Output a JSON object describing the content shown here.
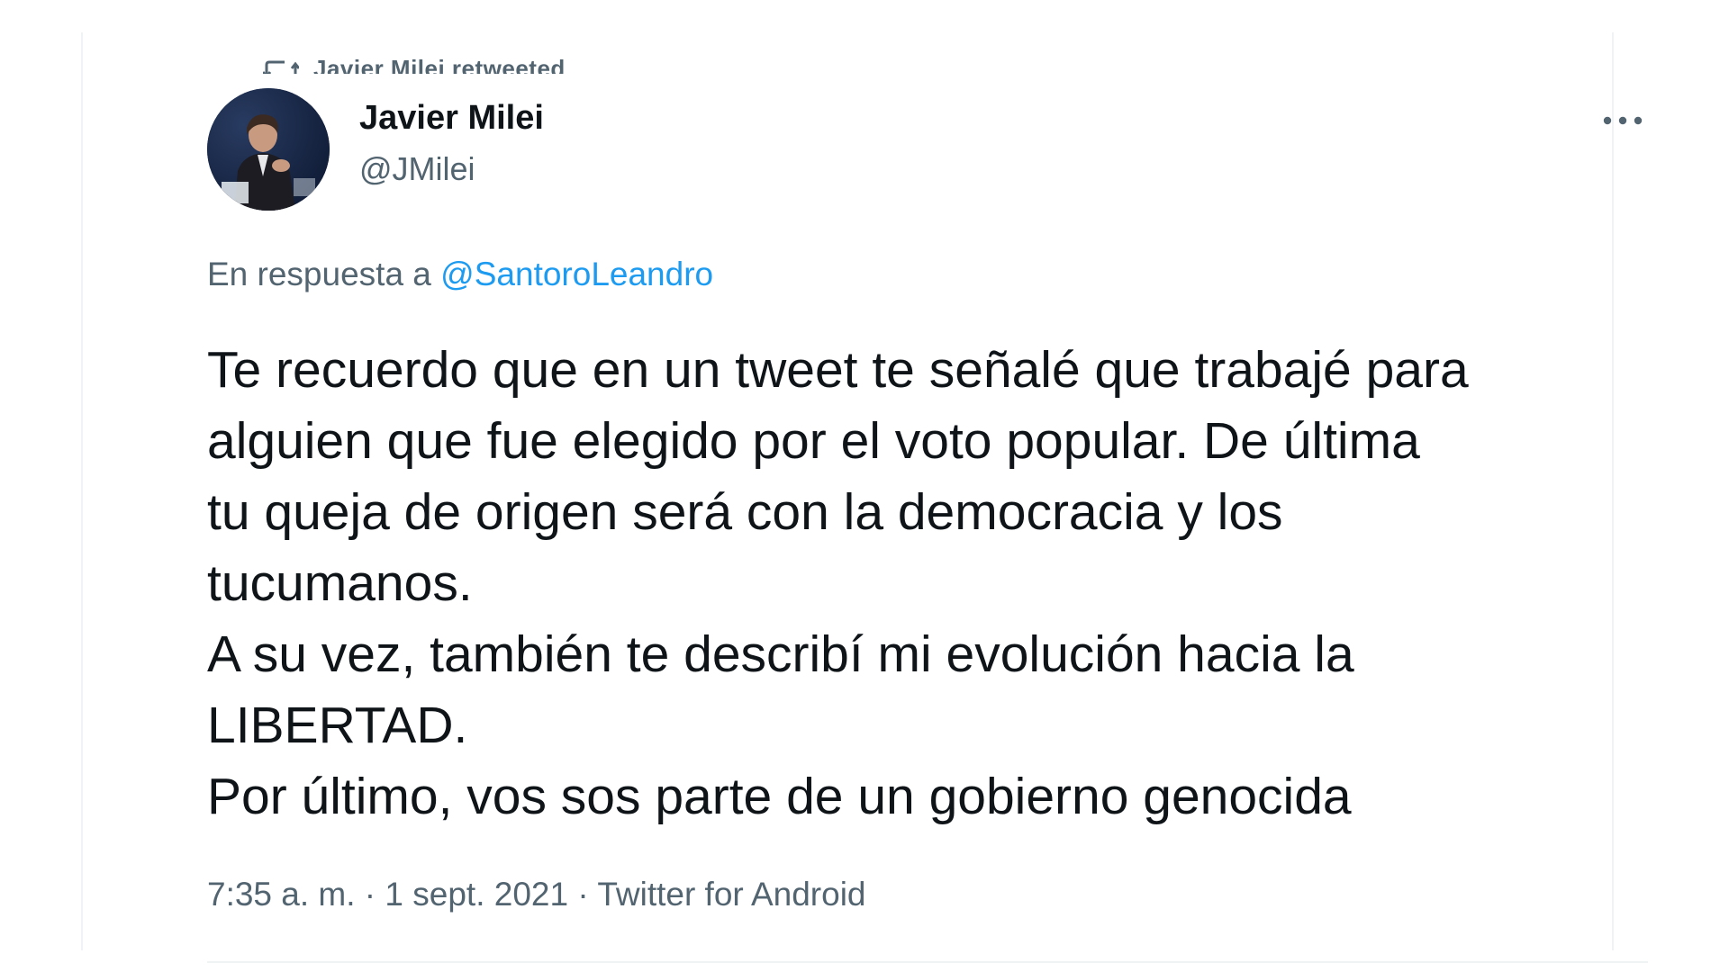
{
  "retweet": {
    "text": "Javier Milei retweeted"
  },
  "author": {
    "name": "Javier Milei",
    "handle": "@JMilei",
    "avatar_icon": "profile-photo-icon"
  },
  "reply": {
    "prefix": "En respuesta a ",
    "mention": "@SantoroLeandro"
  },
  "tweet": {
    "lines": [
      "Te recuerdo que en un tweet te señalé que trabajé para",
      "alguien que fue elegido por el voto popular. De última",
      "tu queja de origen será con la democracia y los",
      "tucumanos.",
      "A su vez, también te describí mi evolución hacia la",
      "LIBERTAD.",
      "Por último, vos sos parte de un gobierno genocida"
    ]
  },
  "meta": {
    "time": "7:35 a. m.",
    "separator": " · ",
    "date": "1 sept. 2021",
    "source": "Twitter for Android"
  },
  "colors": {
    "text_primary": "#0f1419",
    "text_secondary": "#536471",
    "link": "#1d9bf0",
    "border": "#eff3f4"
  },
  "icons": {
    "more": "more-dots-icon",
    "retweet": "retweet-icon"
  }
}
